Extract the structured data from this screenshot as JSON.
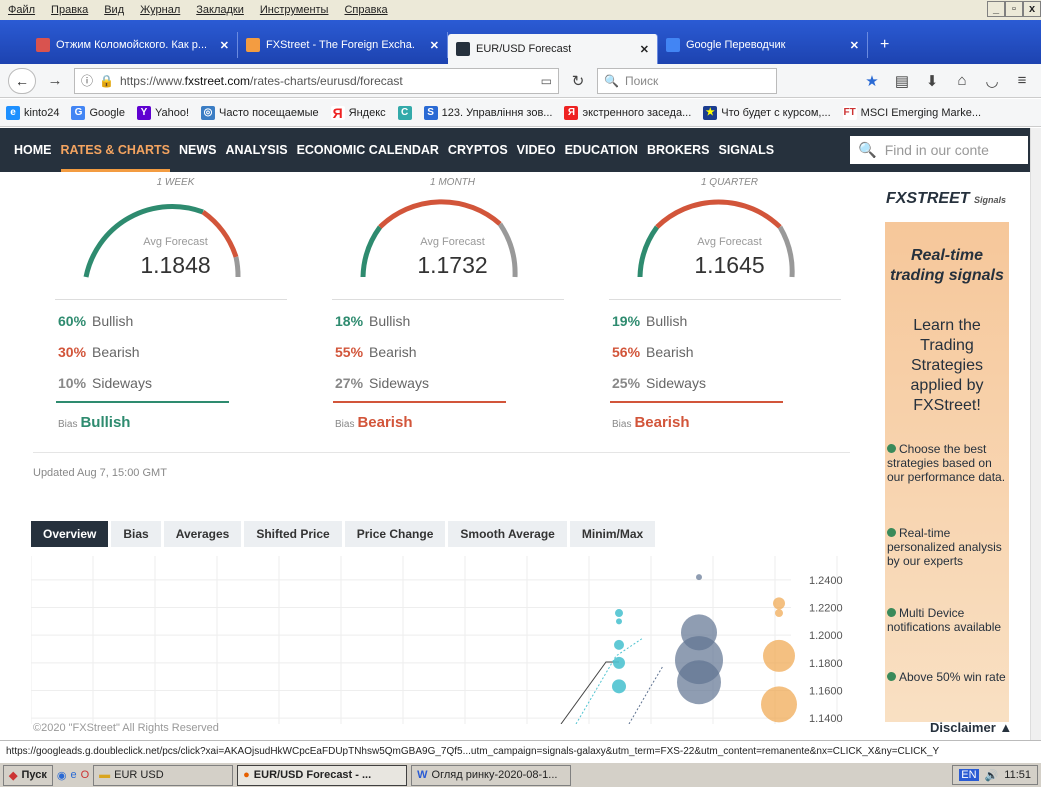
{
  "menubar": {
    "items": [
      "Файл",
      "Правка",
      "Вид",
      "Журнал",
      "Закладки",
      "Инструменты",
      "Справка"
    ],
    "controls": [
      "_",
      "▫",
      "x"
    ]
  },
  "tabs": [
    {
      "title": "Отжим Коломойского. Как р...",
      "icon_color": "#d9534f"
    },
    {
      "title": "FXStreet - The Foreign Excha...",
      "icon_color": "#f39c41"
    },
    {
      "title": "EUR/USD Forecast",
      "icon_color": "#26313d"
    },
    {
      "title": "Google Переводчик",
      "icon_color": "#4285f4"
    }
  ],
  "active_tab": 2,
  "nav": {
    "url_prefix": "https://www.",
    "url_domain": "fxstreet.com",
    "url_path": "/rates-charts/eurusd/forecast",
    "search_placeholder": "Поиск"
  },
  "bookmarks": [
    {
      "label": "kinto24",
      "color": "#1e90ff"
    },
    {
      "label": "Google",
      "color": "#4285f4"
    },
    {
      "label": "Yahoo!",
      "color": "#5f01d1"
    },
    {
      "label": "Часто посещаемые",
      "color": "#3b7dc4"
    },
    {
      "label": "Яндекс",
      "color": "#e22"
    },
    {
      "label": "",
      "color": "#3aa"
    },
    {
      "label": "123. Управління зов...",
      "color": "#2a6ad4"
    },
    {
      "label": "экстренного заседа...",
      "color": "#e22"
    },
    {
      "label": "Что будет с курсом,...",
      "color": "#1b3d8f"
    },
    {
      "label": "MSCI Emerging Marke...",
      "color": "#c33"
    }
  ],
  "sitenav": {
    "items": [
      "HOME",
      "RATES & CHARTS",
      "NEWS",
      "ANALYSIS",
      "ECONOMIC CALENDAR",
      "CRYPTOS",
      "VIDEO",
      "EDUCATION",
      "BROKERS",
      "SIGNALS"
    ],
    "active": 1,
    "search_placeholder": "Find in our conte"
  },
  "forecasts": [
    {
      "period": "1 WEEK",
      "avg_label": "Avg Forecast",
      "avg": "1.1848",
      "bullish": "60%",
      "bearish": "30%",
      "sideways": "10%",
      "bias": "Bullish",
      "bias_color": "#2e8b6f"
    },
    {
      "period": "1 MONTH",
      "avg_label": "Avg Forecast",
      "avg": "1.1732",
      "bullish": "18%",
      "bearish": "55%",
      "sideways": "27%",
      "bias": "Bearish",
      "bias_color": "#d2553a"
    },
    {
      "period": "1 QUARTER",
      "avg_label": "Avg Forecast",
      "avg": "1.1645",
      "bullish": "19%",
      "bearish": "56%",
      "sideways": "25%",
      "bias": "Bearish",
      "bias_color": "#d2553a"
    }
  ],
  "labels": {
    "bullish": "Bullish",
    "bearish": "Bearish",
    "sideways": "Sideways",
    "bias": "Bias"
  },
  "colors": {
    "bull": "#2e8b6f",
    "bear": "#d2553a",
    "side": "#999999",
    "nav_bg": "#26313d",
    "accent": "#f39c41"
  },
  "updated": "Updated Aug 7, 15:00 GMT",
  "chart_tabs": [
    "Overview",
    "Bias",
    "Averages",
    "Shifted Price",
    "Price Change",
    "Smooth Average",
    "Minim/Max"
  ],
  "chart_data": {
    "type": "scatter",
    "y_ticks": [
      "1.2400",
      "1.2200",
      "1.2000",
      "1.1800",
      "1.1600",
      "1.1400"
    ],
    "ylim": [
      1.13,
      1.25
    ],
    "series": [
      {
        "color": "#4fc3d0",
        "points": [
          [
            0.0,
            1.216
          ],
          [
            0.0,
            1.21
          ],
          [
            0.0,
            1.193
          ],
          [
            0.0,
            1.18
          ],
          [
            0.0,
            1.163
          ]
        ]
      },
      {
        "color": "#5f7391",
        "points": [
          [
            0.5,
            1.242
          ],
          [
            0.5,
            1.202
          ],
          [
            0.5,
            1.182
          ],
          [
            0.5,
            1.166
          ]
        ]
      },
      {
        "color": "#f0a54b",
        "points": [
          [
            1.0,
            1.223
          ],
          [
            1.0,
            1.216
          ],
          [
            1.0,
            1.185
          ],
          [
            1.0,
            1.15
          ]
        ]
      }
    ],
    "price_line": [
      [
        1.11,
        -0.75
      ],
      [
        1.182,
        -0.3
      ],
      [
        1.185,
        -0.1
      ]
    ]
  },
  "ad": {
    "brand": "FXSTREET",
    "brand_sub": "Signals",
    "headline": "Real-time trading signals",
    "body": "Learn the Trading Strategies applied by FXStreet!",
    "bullets": [
      "Choose the best strategies based on our performance data.",
      "Real-time personalized analysis by our experts",
      "Multi Device notifications available",
      "Above 50% win rate"
    ]
  },
  "footer": {
    "copyright": "©2020 \"FXStreet\" All Rights Reserved",
    "disclaimer": "Disclaimer ▲"
  },
  "status_url": "https://googleads.g.doubleclick.net/pcs/click?xai=AKAOjsudHkWCpcEaFDUpTNhsw5QmGBA9G_7Qf5...utm_campaign=signals-galaxy&utm_term=FXS-22&utm_content=remanente&nx=CLICK_X&ny=CLICK_Y",
  "taskbar": {
    "start": "Пуск",
    "items": [
      "EUR USD",
      "EUR/USD Forecast - ...",
      "Огляд ринку-2020-08-1..."
    ],
    "lang": "EN",
    "time": "11:51"
  }
}
